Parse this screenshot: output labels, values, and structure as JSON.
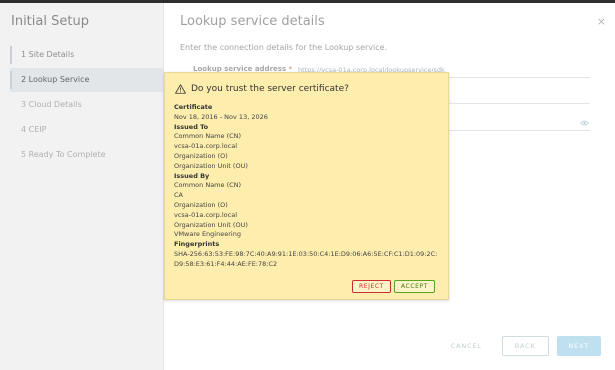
{
  "sidebar": {
    "title": "Initial Setup",
    "steps": [
      {
        "label": "1  Site Details"
      },
      {
        "label": "2  Lookup Service"
      },
      {
        "label": "3   Cloud Details"
      },
      {
        "label": "4  CEIP"
      },
      {
        "label": "5  Ready To Complete"
      }
    ]
  },
  "main": {
    "title": "Lookup service details",
    "description": "Enter the connection details for the Lookup service.",
    "field_label": "Lookup service address",
    "required_mark": "*",
    "field_value": "https://vcsa-01a.corp.local/lookupservice/sdk",
    "close": "×"
  },
  "footer": {
    "cancel": "CANCEL",
    "back": "BACK",
    "next": "NEXT"
  },
  "dialog": {
    "title": "Do you trust the server certificate?",
    "certificate_heading": "Certificate",
    "validity": "Nov 18, 2016 - Nov 13, 2026",
    "issued_to_heading": "Issued To",
    "issued_to": [
      "Common Name (CN)",
      "vcsa-01a.corp.local",
      "Organization (O)",
      "Organization Unit (OU)"
    ],
    "issued_by_heading": "Issued By",
    "issued_by": [
      "Common Name (CN)",
      "CA",
      "Organization (O)",
      "vcsa-01a.corp.local",
      "Organization Unit (OU)",
      "VMware Engineering"
    ],
    "fingerprints_heading": "Fingerprints",
    "fingerprint": "SHA-256:63:53:FE:98:7C:40:A9:91:1E:03:50:C4:1E:D9:06:A6:5E:CF:C1:D1:09:2C:D9:58:E3:61:F4:44:AE:FE:78:C2",
    "reject": "REJECT",
    "accept": "ACCEPT"
  },
  "colors": {
    "dialog_bg": "#fdeeae",
    "reject": "#c9302c",
    "accept": "#5aa220"
  }
}
